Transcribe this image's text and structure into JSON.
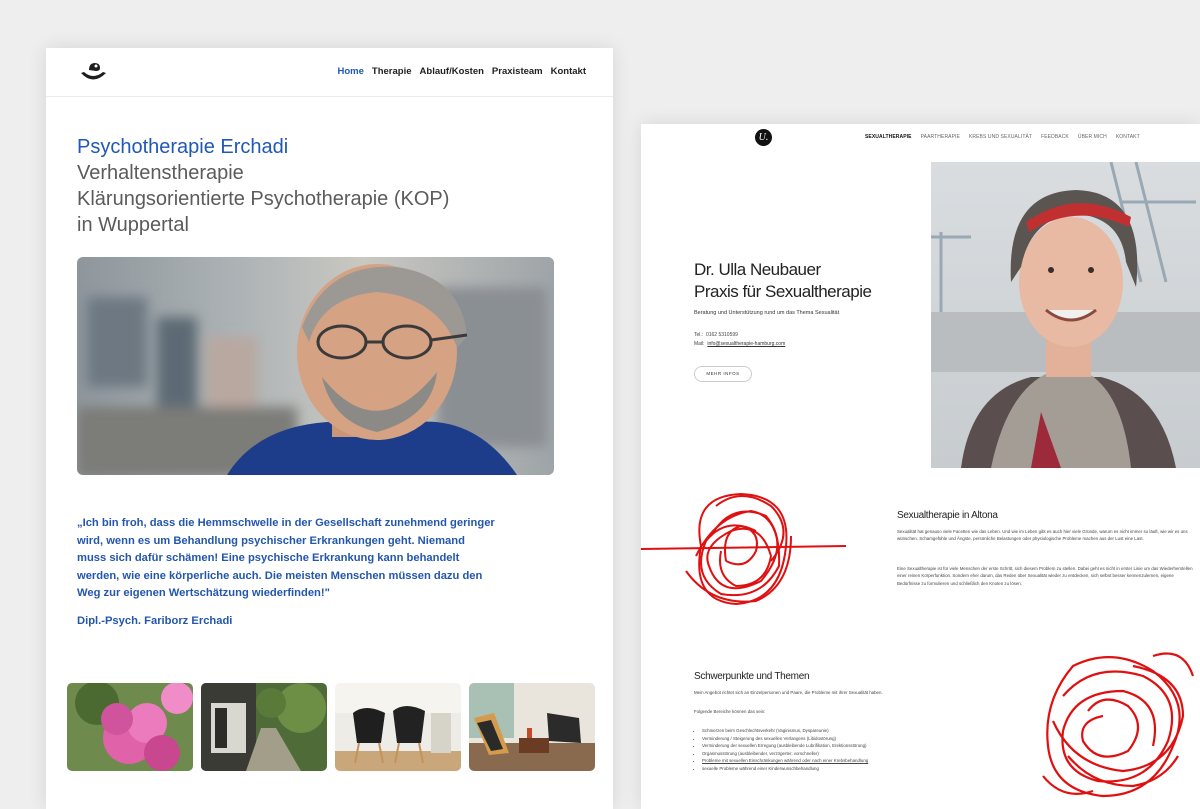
{
  "left_site": {
    "nav": [
      "Home",
      "Therapie",
      "Ablauf/Kosten",
      "Praxisteam",
      "Kontakt"
    ],
    "nav_active": "Home",
    "title_lines": [
      "Psychotherapie Erchadi",
      "Verhaltenstherapie",
      "Klärungsorientierte Psychotherapie (KOP)",
      "in Wuppertal"
    ],
    "quote": "„Ich bin froh, dass die Hemmschwelle in der Gesellschaft zunehmend geringer wird, wenn es um Behandlung psychischer Erkrankungen geht. Niemand muss sich dafür schämen! Eine psychische Erkrankung kann behandelt werden, wie eine körperliche auch. Die meisten Menschen müssen dazu den Weg zur eigenen Wertschätzung wiederfinden!\"",
    "author": "Dipl.-Psych. Fariborz Erchadi",
    "colors": {
      "accent": "#1f58b5",
      "title_gray": "#5b5b5b"
    }
  },
  "right_site": {
    "logo_letter": "U.",
    "nav": [
      "SEXUALTHERAPIE",
      "PAARTHERAPIE",
      "KREBS UND SEXUALITÄT",
      "FEEDBACK",
      "ÜBER MICH",
      "KONTAKT"
    ],
    "nav_active": "SEXUALTHERAPIE",
    "name_line1": "Dr. Ulla Neubauer",
    "name_line2": "Praxis für Sexualtherapie",
    "subline": "Beratung und Unterstützung rund um das Thema Sexualität",
    "tel_label": "Tel.:",
    "tel_value": "0162 5310599",
    "mail_label": "Mail:",
    "mail_value": "info@sexualtherapie-hamburg.com",
    "button": "MEHR INFOS",
    "section2": {
      "title": "Sexualtherapie in Altona",
      "p1": "Sexualität hat genauso viele Facetten wie das Leben. Und wie im Leben gibt es auch hier viele Gründe, warum es nicht immer so läuft, wie wir es uns wünschen. Schamgefühle und Ängste, persönliche Belastungen oder physiologische Probleme machen aus der Lust eine Last.",
      "p2": "Eine Sexualtherapie ist für viele Menschen der erste Schritt, sich diesem Problem zu stellen. Dabei geht es nicht in erster Linie um das Wiederherstellen einer reinen Körperfunktion. Sondern eher darum, das Reden über Sexualität wieder zu entdecken, sich selbst besser kennenzulernen, eigene Bedürfnisse zu formulieren und schließlich den Knoten zu lösen."
    },
    "section3": {
      "title": "Schwerpunkte und Themen",
      "intro": "Mein Angebot richtet sich an Einzelpersonen und Paare, die Probleme mit ihrer Sexualität haben.",
      "sub": "Folgende Bereiche können das sein:",
      "items": [
        "Schmerzen beim Geschlechtsverkehr (Vaginismus, Dyspareunie)",
        "Verminderung / Steigerung des sexuellen Verlangens (Libidostörung)",
        "Verminderung der sexuellen Erregung (ausbleibende Lubrifikation, Erektionsstörung)",
        "Orgasmusstörung (ausbleibender, verzögerter, vorschneller)",
        "Probleme mit sexuellen Einschränkungen während oder nach einer Krebsbehandlung",
        "sexuelle Probleme während einer Kinderwunschbehandlung"
      ]
    },
    "colors": {
      "scribble": "#e01010"
    }
  }
}
